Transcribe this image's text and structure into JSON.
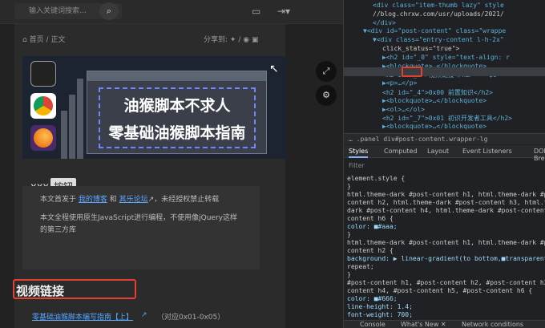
{
  "topbar": {
    "search_placeholder": "输入关键词搜索…",
    "search_icon": "search-icon",
    "chat_icon": "chat-icon",
    "login_icon": "login-icon"
  },
  "breadcrumb": {
    "home": "首页",
    "sep": "/",
    "current": "正文"
  },
  "share": {
    "label": "分享到:",
    "icons": [
      "weibo-icon",
      "pen-icon",
      "camera-icon"
    ]
  },
  "hero": {
    "line1": "油猴脚本不求人",
    "line2": "零基础油猴脚本指南"
  },
  "heading_xxx": {
    "text": "xxx",
    "button": "按钮"
  },
  "quote": {
    "l1_prefix": "本文首发于",
    "l1_link1": "我的博客",
    "l1_and": "和",
    "l1_link2": "其乐论坛",
    "l1_suffix": "，未经授权禁止转载",
    "l2": "本文全程使用原生JavaScript进行编程，不使用像jQuery这样的第三方库"
  },
  "section": {
    "title": "视频链接"
  },
  "link": {
    "text": "零基础油猴脚本编写指南【上】",
    "note": "（对应0x01-0x05）"
  },
  "side_buttons": [
    "expand-icon",
    "gear-icon"
  ],
  "devtools": {
    "lines": [
      {
        "indent": 3,
        "text": "<div class=\"item-thumb lazy\" style"
      },
      {
        "indent": 3,
        "text": "//blog.chrxw.com/usr/uploads/2021/"
      },
      {
        "indent": 3,
        "text": "</div>"
      },
      {
        "indent": 2,
        "text": "▼<div id=\"post-content\" class=\"wrappe"
      },
      {
        "indent": 3,
        "text": "▼<div class=\"entry-content l-h-2x\""
      },
      {
        "indent": 4,
        "text": "click_status=\"true\">"
      },
      {
        "indent": 4,
        "text": "▶<h2 id=\"_0\" style=\"text-align: r"
      },
      {
        "indent": 4,
        "text": "▶<blockquote>…</blockquote>"
      },
      {
        "indent": 4,
        "text": "<h2 id=\"_2\">视频链接</h2> == $0"
      },
      {
        "indent": 4,
        "text": "▶<p>…</p>"
      },
      {
        "indent": 4,
        "text": "<h2 id=\"_4\">0x00 前置知识</h2>"
      },
      {
        "indent": 4,
        "text": "▶<blockquote>…</blockquote>"
      },
      {
        "indent": 4,
        "text": "▶<ol>…</ol>"
      },
      {
        "indent": 4,
        "text": "<h2 id=\"_7\">0x01 初识开发者工具</h2>"
      },
      {
        "indent": 4,
        "text": "▶<blockquote>…</blockquote>"
      }
    ],
    "crumbs": "…  .panel  div#post-content.wrapper-lg  div#md_handsome_orig",
    "tabs": [
      "Styles",
      "Computed",
      "Layout",
      "Event Listeners",
      "DOM Breakpo"
    ],
    "filter_label": "Filter",
    "css_lines": [
      "element.style {",
      "}",
      "html.theme-dark #post-content h1, html.theme-dark #po",
      "content h2, html.theme-dark #post-content h3, html.th",
      "dark #post-content h4, html.theme-dark #post-content h",
      "content h6 {",
      "  color: ■#aaa;",
      "}",
      "html.theme-dark #post-content h1, html.theme-dark #po",
      "content h2 {",
      "  background: ▶ linear-gradient(to bottom,■transparent",
      "      repeat;",
      "}",
      "#post-content h1, #post-content h2, #post-content h3, #p",
      "content h4, #post-content h5, #post-content h6 {",
      "  color: ■#666;",
      "  line-height: 1.4;",
      "  font-weight: 700;"
    ],
    "bottom_tabs": [
      "Console",
      "What's New ✕",
      "Network conditions"
    ]
  }
}
